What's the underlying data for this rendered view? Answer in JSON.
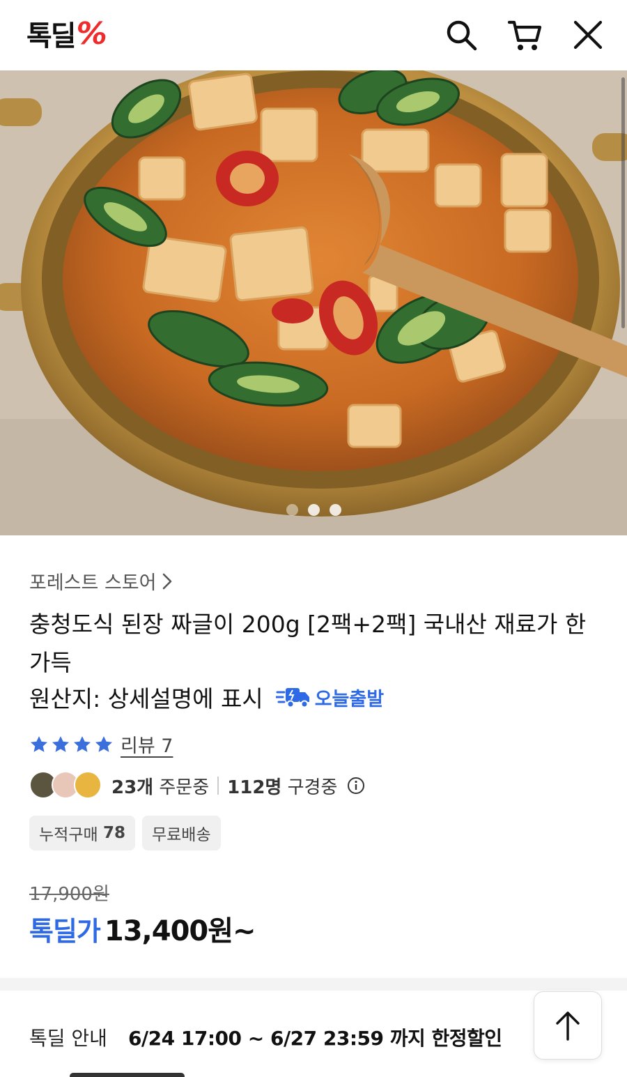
{
  "header": {
    "logo_text": "톡딜",
    "logo_mark": "%",
    "icons": [
      "search-icon",
      "cart-icon",
      "close-icon"
    ]
  },
  "hero": {
    "image_description": "Korean doenjang jjigae stew with tofu and peppers in a gold pot with wooden spoon",
    "slide_count": 3,
    "active_slide": 1
  },
  "product": {
    "store_name": "포레스트 스토어",
    "title": "충청도식 된장 짜글이 200g [2팩+2팩] 국내산 재료가 한가득",
    "origin": "원산지: 상세설명에 표시",
    "shipping_badge": "오늘출발",
    "rating_stars": 4,
    "review_label": "리뷰 7",
    "orders_count": "23개",
    "orders_label": "주문중",
    "viewers_count": "112명",
    "viewers_label": "구경중",
    "chips": {
      "cumulative_label": "누적구매",
      "cumulative_count": "78",
      "free_shipping": "무료배송"
    },
    "original_price": "17,900원",
    "deal_label": "톡딜가",
    "deal_price": "13,400원~"
  },
  "deal_info": {
    "label": "톡딜 안내",
    "period": "6/24 17:00 ~ 6/27 23:59 까지 한정할인"
  },
  "colors": {
    "accent_blue": "#2e6ae6",
    "logo_red": "#ee2c2c",
    "star_blue": "#3a6fdc"
  }
}
